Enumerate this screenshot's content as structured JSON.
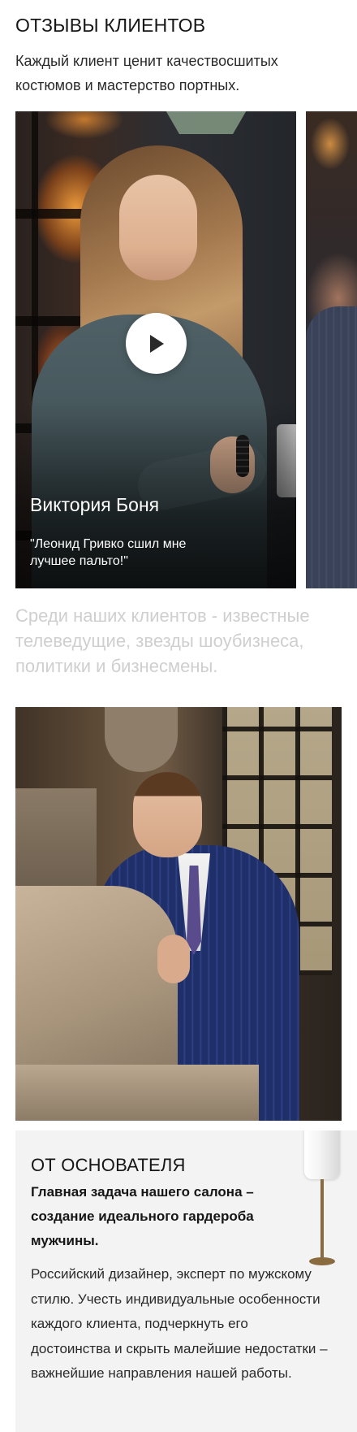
{
  "reviews": {
    "title": "ОТЗЫВЫ КЛИЕНТОВ",
    "subtitle": "Каждый клиент ценит качествосшитых костюмов и мастерство портных.",
    "items": [
      {
        "name": "Виктория Боня",
        "quote": "\"Леонид Гривко сшил мне лучшее пальто!\""
      }
    ]
  },
  "celebrities": {
    "text": "Среди наших клиентов - известные телеведущие, звезды шоубизнеса, политики и бизнесмены."
  },
  "founder": {
    "title": "ОТ ОСНОВАТЕЛЯ",
    "lead": "Главная задача нашего салона – создание идеального гардероба мужчины.",
    "text": "Российский дизайнер, эксперт по мужскому стилю. Учесть индивидуальные особенности каждого клиента, подчеркнуть его достоинства и скрыть малейшие недостатки – важнейшие направления нашей работы."
  },
  "colors": {
    "text": "#161616",
    "muted": "#cfcfcf",
    "panel": "#f3f3f3"
  },
  "icons": {
    "play": "play-icon"
  }
}
